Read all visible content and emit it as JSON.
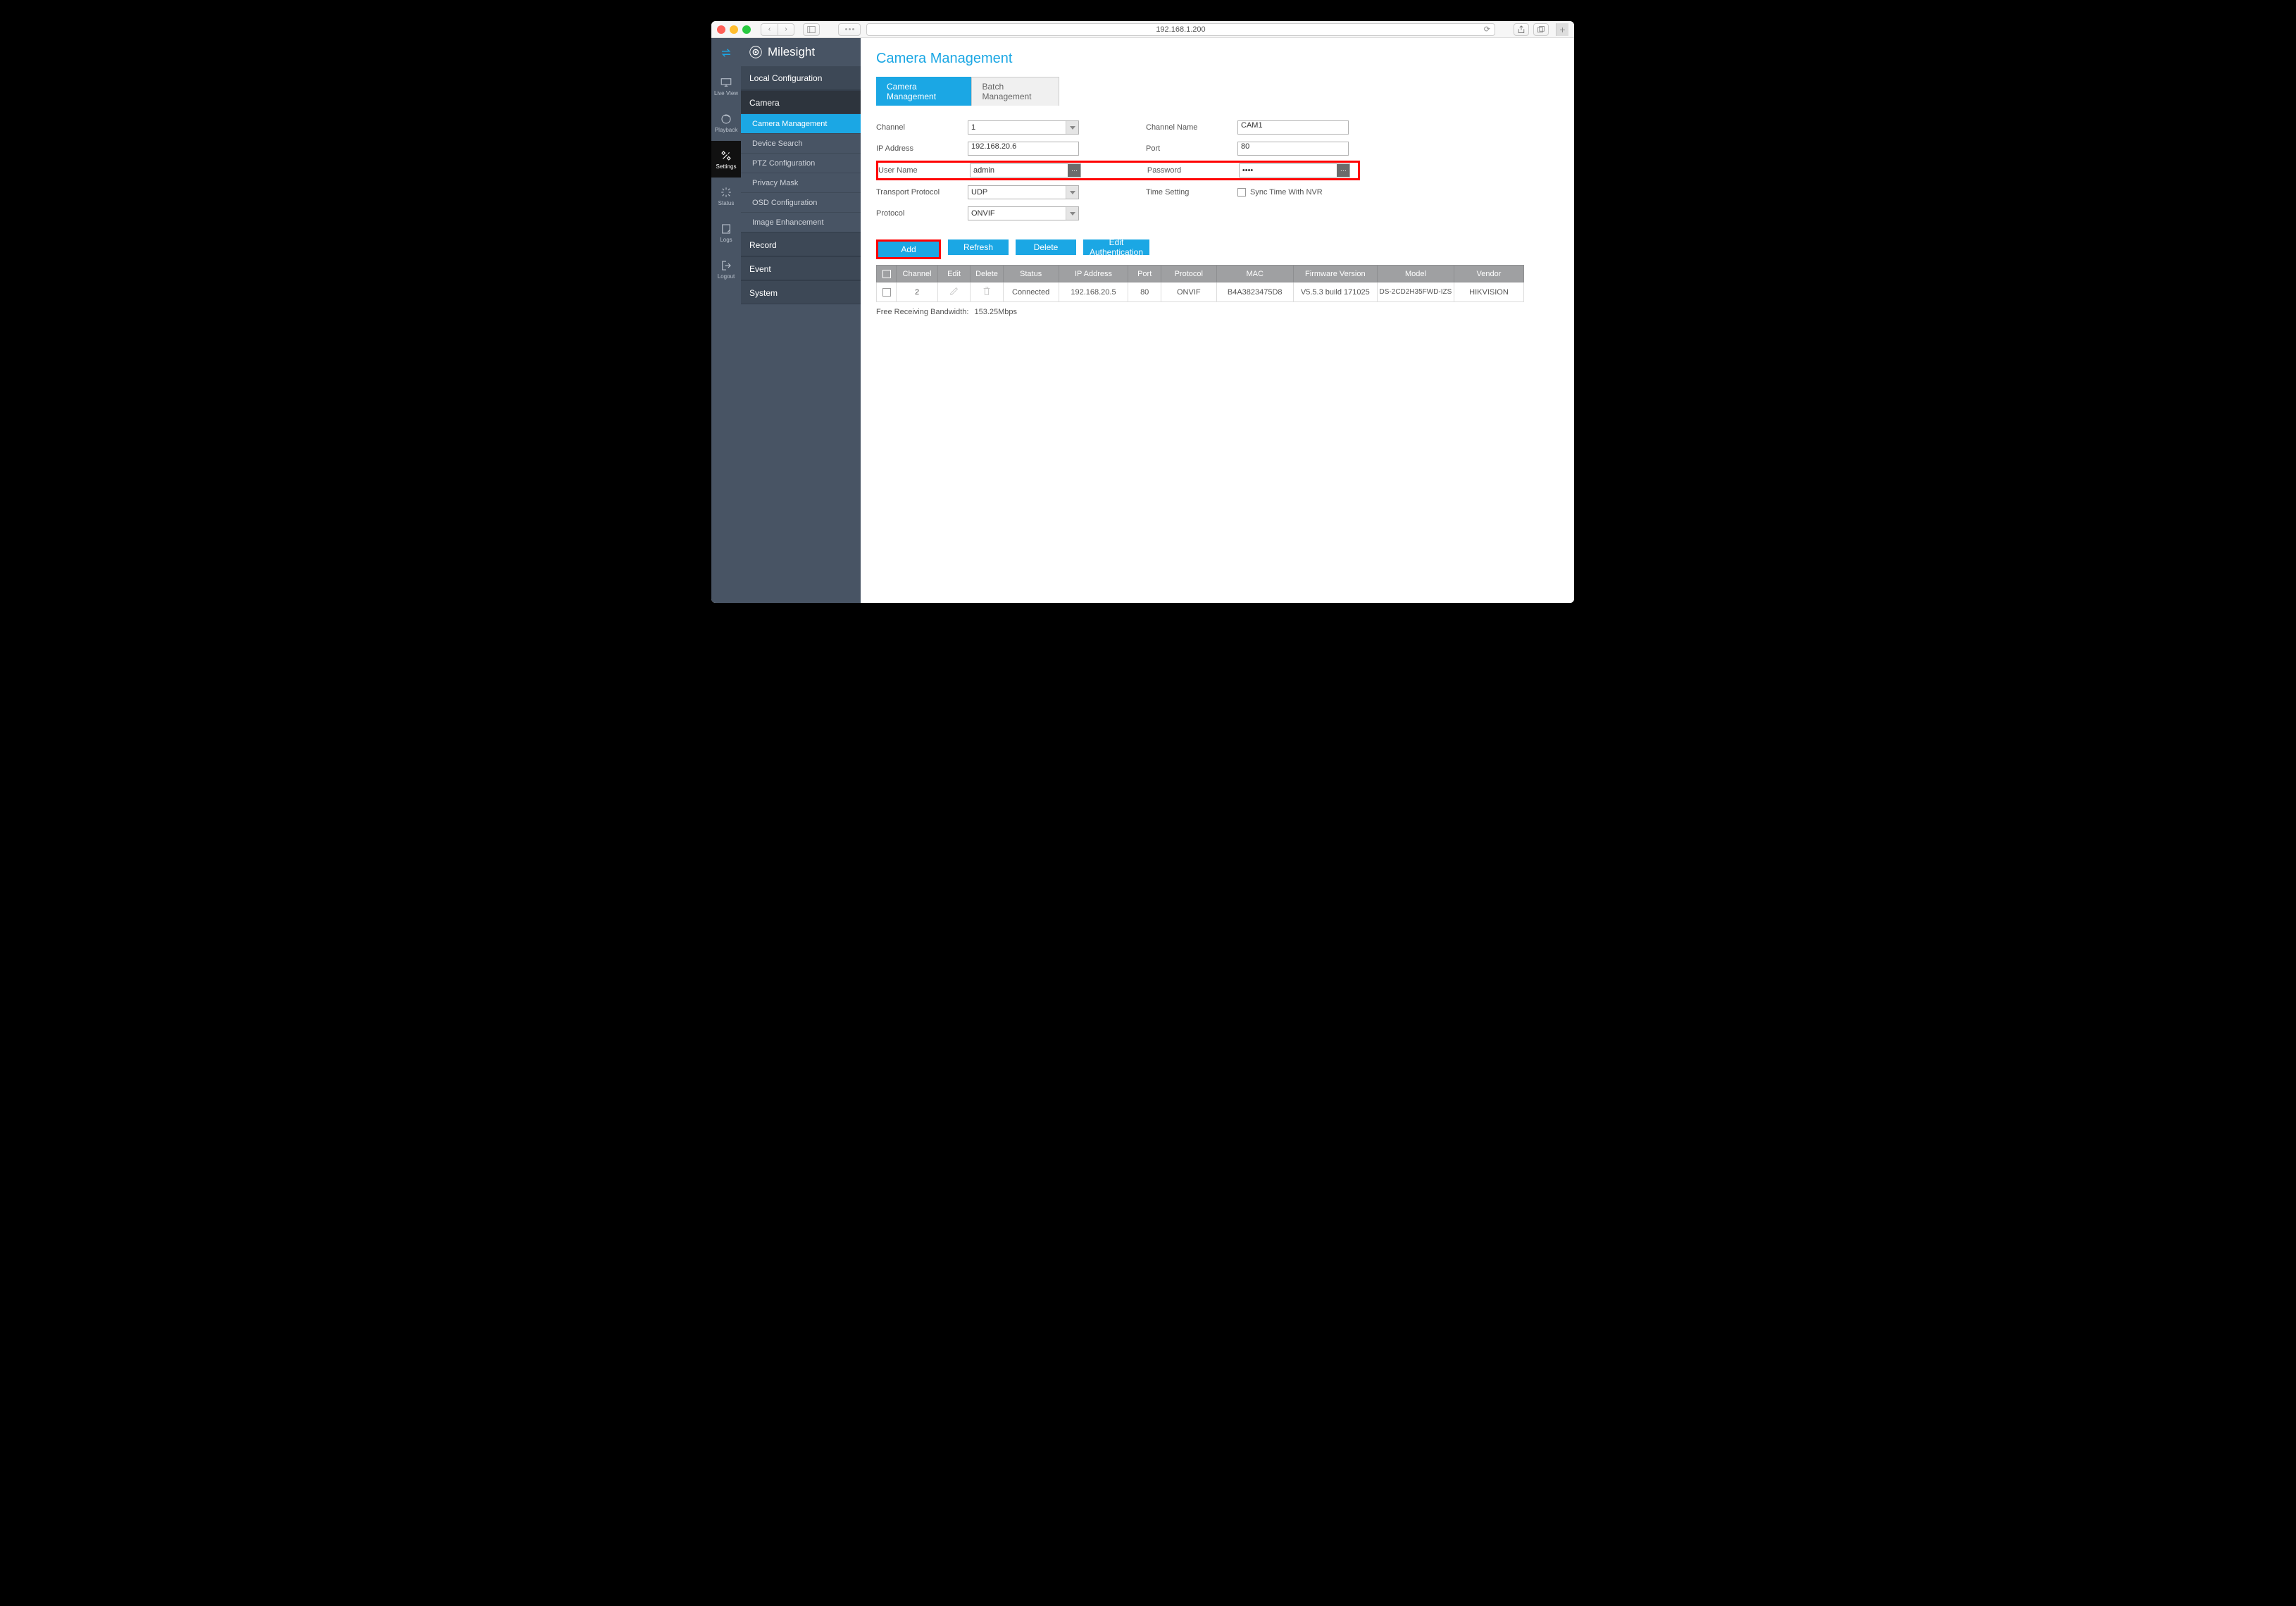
{
  "browser": {
    "address": "192.168.1.200"
  },
  "iconSidebar": [
    {
      "label": ""
    },
    {
      "label": "Live View"
    },
    {
      "label": "Playback"
    },
    {
      "label": "Settings"
    },
    {
      "label": "Status"
    },
    {
      "label": "Logs"
    },
    {
      "label": "Logout"
    }
  ],
  "brand": "Milesight",
  "menu": {
    "localConfig": "Local Configuration",
    "camera": "Camera",
    "cameraSubs": [
      "Camera Management",
      "Device Search",
      "PTZ Configuration",
      "Privacy Mask",
      "OSD Configuration",
      "Image Enhancement"
    ],
    "record": "Record",
    "event": "Event",
    "system": "System"
  },
  "page": {
    "title": "Camera Management",
    "tabs": [
      "Camera Management",
      "Batch Management"
    ]
  },
  "form": {
    "channel": {
      "label": "Channel",
      "value": "1"
    },
    "ip": {
      "label": "IP Address",
      "value": "192.168.20.6"
    },
    "user": {
      "label": "User Name",
      "value": "admin"
    },
    "transport": {
      "label": "Transport Protocol",
      "value": "UDP"
    },
    "protocol": {
      "label": "Protocol",
      "value": "ONVIF"
    },
    "channelName": {
      "label": "Channel Name",
      "value": "CAM1"
    },
    "port": {
      "label": "Port",
      "value": "80"
    },
    "password": {
      "label": "Password",
      "value": "••••"
    },
    "timeSetting": {
      "label": "Time Setting",
      "checkbox": "Sync Time With NVR"
    }
  },
  "buttons": {
    "add": "Add",
    "refresh": "Refresh",
    "delete": "Delete",
    "editAuth": "Edit Authentication"
  },
  "table": {
    "headers": [
      "",
      "Channel",
      "Edit",
      "Delete",
      "Status",
      "IP Address",
      "Port",
      "Protocol",
      "MAC",
      "Firmware Version",
      "Model",
      "Vendor"
    ],
    "row": {
      "channel": "2",
      "status": "Connected",
      "ip": "192.168.20.5",
      "port": "80",
      "protocol": "ONVIF",
      "mac": "B4A3823475D8",
      "fw": "V5.5.3 build 171025",
      "model": "DS-2CD2H35FWD-IZS",
      "vendor": "HIKVISION"
    }
  },
  "bandwidth": {
    "label": "Free Receiving Bandwidth:",
    "value": "153.25Mbps"
  }
}
